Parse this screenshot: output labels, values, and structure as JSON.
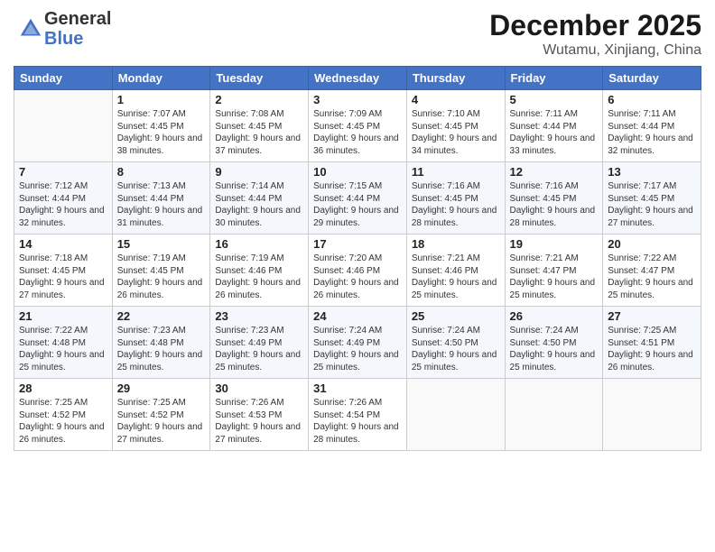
{
  "header": {
    "logo_general": "General",
    "logo_blue": "Blue",
    "title": "December 2025",
    "location": "Wutamu, Xinjiang, China"
  },
  "days_of_week": [
    "Sunday",
    "Monday",
    "Tuesday",
    "Wednesday",
    "Thursday",
    "Friday",
    "Saturday"
  ],
  "weeks": [
    [
      {
        "day": "",
        "sunrise": "",
        "sunset": "",
        "daylight": ""
      },
      {
        "day": "1",
        "sunrise": "Sunrise: 7:07 AM",
        "sunset": "Sunset: 4:45 PM",
        "daylight": "Daylight: 9 hours and 38 minutes."
      },
      {
        "day": "2",
        "sunrise": "Sunrise: 7:08 AM",
        "sunset": "Sunset: 4:45 PM",
        "daylight": "Daylight: 9 hours and 37 minutes."
      },
      {
        "day": "3",
        "sunrise": "Sunrise: 7:09 AM",
        "sunset": "Sunset: 4:45 PM",
        "daylight": "Daylight: 9 hours and 36 minutes."
      },
      {
        "day": "4",
        "sunrise": "Sunrise: 7:10 AM",
        "sunset": "Sunset: 4:45 PM",
        "daylight": "Daylight: 9 hours and 34 minutes."
      },
      {
        "day": "5",
        "sunrise": "Sunrise: 7:11 AM",
        "sunset": "Sunset: 4:44 PM",
        "daylight": "Daylight: 9 hours and 33 minutes."
      },
      {
        "day": "6",
        "sunrise": "Sunrise: 7:11 AM",
        "sunset": "Sunset: 4:44 PM",
        "daylight": "Daylight: 9 hours and 32 minutes."
      }
    ],
    [
      {
        "day": "7",
        "sunrise": "Sunrise: 7:12 AM",
        "sunset": "Sunset: 4:44 PM",
        "daylight": "Daylight: 9 hours and 32 minutes."
      },
      {
        "day": "8",
        "sunrise": "Sunrise: 7:13 AM",
        "sunset": "Sunset: 4:44 PM",
        "daylight": "Daylight: 9 hours and 31 minutes."
      },
      {
        "day": "9",
        "sunrise": "Sunrise: 7:14 AM",
        "sunset": "Sunset: 4:44 PM",
        "daylight": "Daylight: 9 hours and 30 minutes."
      },
      {
        "day": "10",
        "sunrise": "Sunrise: 7:15 AM",
        "sunset": "Sunset: 4:44 PM",
        "daylight": "Daylight: 9 hours and 29 minutes."
      },
      {
        "day": "11",
        "sunrise": "Sunrise: 7:16 AM",
        "sunset": "Sunset: 4:45 PM",
        "daylight": "Daylight: 9 hours and 28 minutes."
      },
      {
        "day": "12",
        "sunrise": "Sunrise: 7:16 AM",
        "sunset": "Sunset: 4:45 PM",
        "daylight": "Daylight: 9 hours and 28 minutes."
      },
      {
        "day": "13",
        "sunrise": "Sunrise: 7:17 AM",
        "sunset": "Sunset: 4:45 PM",
        "daylight": "Daylight: 9 hours and 27 minutes."
      }
    ],
    [
      {
        "day": "14",
        "sunrise": "Sunrise: 7:18 AM",
        "sunset": "Sunset: 4:45 PM",
        "daylight": "Daylight: 9 hours and 27 minutes."
      },
      {
        "day": "15",
        "sunrise": "Sunrise: 7:19 AM",
        "sunset": "Sunset: 4:45 PM",
        "daylight": "Daylight: 9 hours and 26 minutes."
      },
      {
        "day": "16",
        "sunrise": "Sunrise: 7:19 AM",
        "sunset": "Sunset: 4:46 PM",
        "daylight": "Daylight: 9 hours and 26 minutes."
      },
      {
        "day": "17",
        "sunrise": "Sunrise: 7:20 AM",
        "sunset": "Sunset: 4:46 PM",
        "daylight": "Daylight: 9 hours and 26 minutes."
      },
      {
        "day": "18",
        "sunrise": "Sunrise: 7:21 AM",
        "sunset": "Sunset: 4:46 PM",
        "daylight": "Daylight: 9 hours and 25 minutes."
      },
      {
        "day": "19",
        "sunrise": "Sunrise: 7:21 AM",
        "sunset": "Sunset: 4:47 PM",
        "daylight": "Daylight: 9 hours and 25 minutes."
      },
      {
        "day": "20",
        "sunrise": "Sunrise: 7:22 AM",
        "sunset": "Sunset: 4:47 PM",
        "daylight": "Daylight: 9 hours and 25 minutes."
      }
    ],
    [
      {
        "day": "21",
        "sunrise": "Sunrise: 7:22 AM",
        "sunset": "Sunset: 4:48 PM",
        "daylight": "Daylight: 9 hours and 25 minutes."
      },
      {
        "day": "22",
        "sunrise": "Sunrise: 7:23 AM",
        "sunset": "Sunset: 4:48 PM",
        "daylight": "Daylight: 9 hours and 25 minutes."
      },
      {
        "day": "23",
        "sunrise": "Sunrise: 7:23 AM",
        "sunset": "Sunset: 4:49 PM",
        "daylight": "Daylight: 9 hours and 25 minutes."
      },
      {
        "day": "24",
        "sunrise": "Sunrise: 7:24 AM",
        "sunset": "Sunset: 4:49 PM",
        "daylight": "Daylight: 9 hours and 25 minutes."
      },
      {
        "day": "25",
        "sunrise": "Sunrise: 7:24 AM",
        "sunset": "Sunset: 4:50 PM",
        "daylight": "Daylight: 9 hours and 25 minutes."
      },
      {
        "day": "26",
        "sunrise": "Sunrise: 7:24 AM",
        "sunset": "Sunset: 4:50 PM",
        "daylight": "Daylight: 9 hours and 25 minutes."
      },
      {
        "day": "27",
        "sunrise": "Sunrise: 7:25 AM",
        "sunset": "Sunset: 4:51 PM",
        "daylight": "Daylight: 9 hours and 26 minutes."
      }
    ],
    [
      {
        "day": "28",
        "sunrise": "Sunrise: 7:25 AM",
        "sunset": "Sunset: 4:52 PM",
        "daylight": "Daylight: 9 hours and 26 minutes."
      },
      {
        "day": "29",
        "sunrise": "Sunrise: 7:25 AM",
        "sunset": "Sunset: 4:52 PM",
        "daylight": "Daylight: 9 hours and 27 minutes."
      },
      {
        "day": "30",
        "sunrise": "Sunrise: 7:26 AM",
        "sunset": "Sunset: 4:53 PM",
        "daylight": "Daylight: 9 hours and 27 minutes."
      },
      {
        "day": "31",
        "sunrise": "Sunrise: 7:26 AM",
        "sunset": "Sunset: 4:54 PM",
        "daylight": "Daylight: 9 hours and 28 minutes."
      },
      {
        "day": "",
        "sunrise": "",
        "sunset": "",
        "daylight": ""
      },
      {
        "day": "",
        "sunrise": "",
        "sunset": "",
        "daylight": ""
      },
      {
        "day": "",
        "sunrise": "",
        "sunset": "",
        "daylight": ""
      }
    ]
  ]
}
